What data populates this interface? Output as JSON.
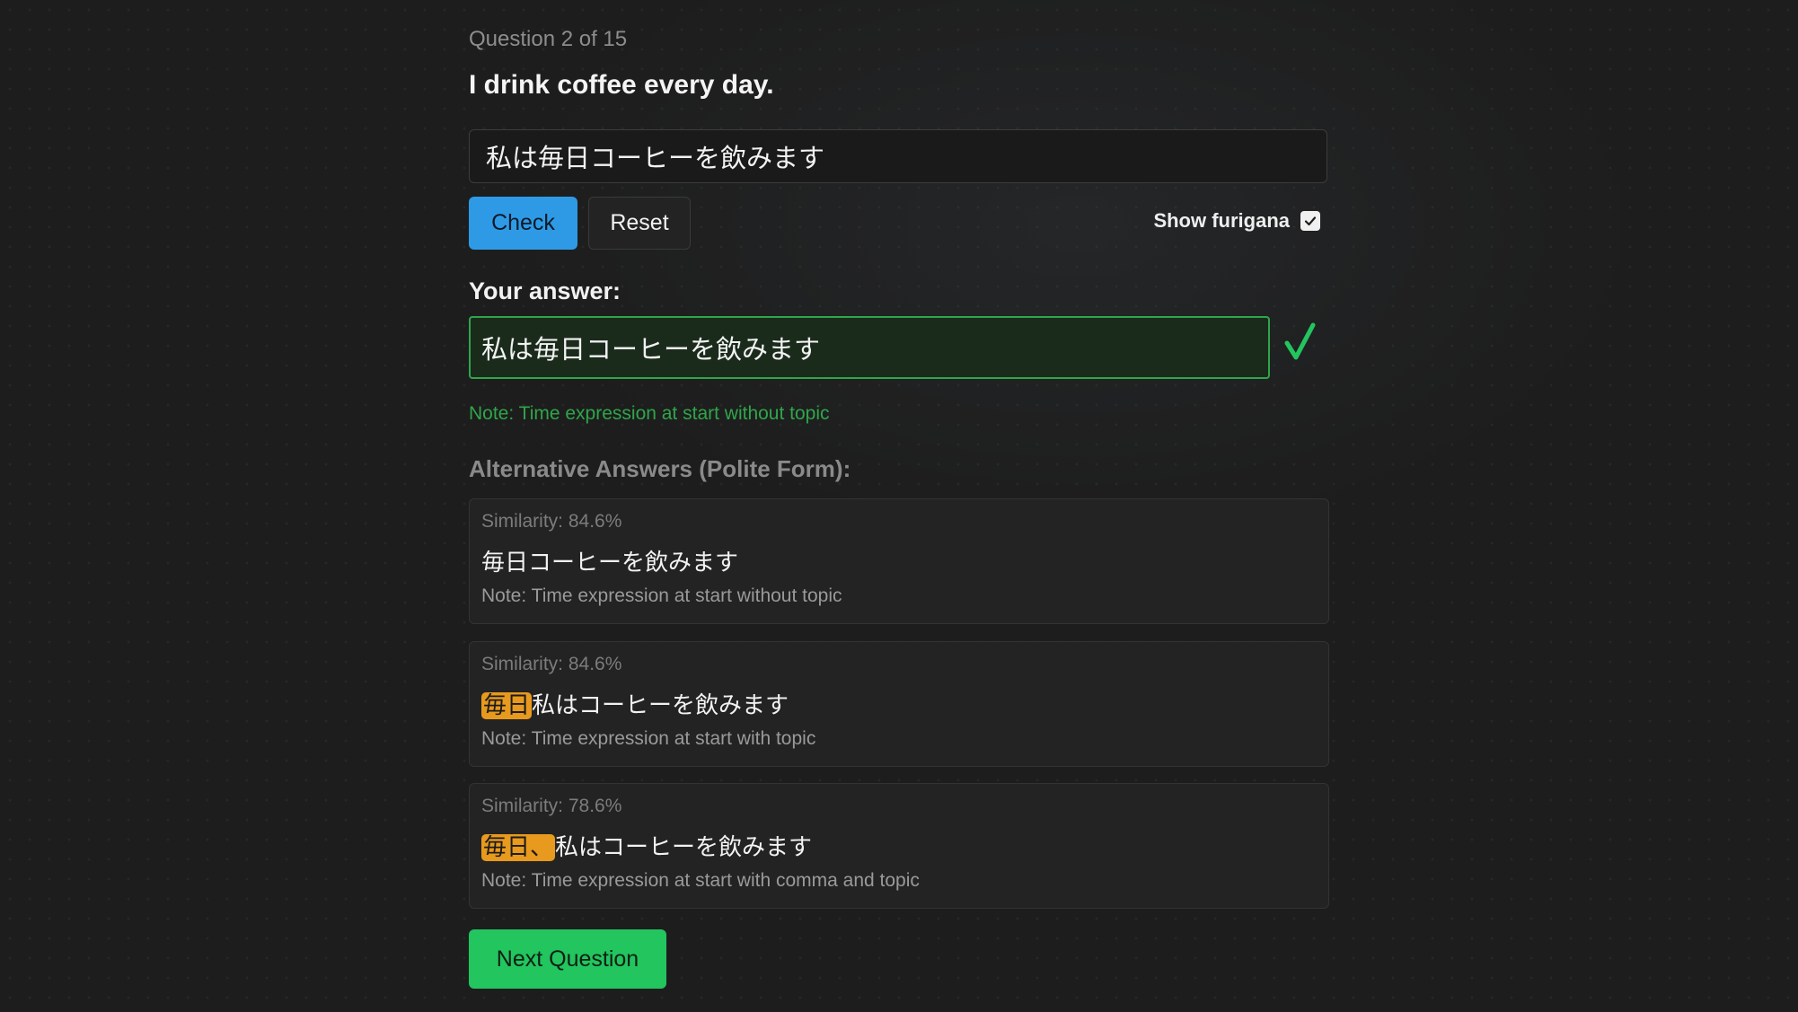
{
  "quiz": {
    "progress": "Question 2 of 15",
    "prompt": "I drink coffee every day."
  },
  "input": {
    "value": "私は毎日コーヒーを飲みます"
  },
  "controls": {
    "check_label": "Check",
    "reset_label": "Reset",
    "furigana_label": "Show furigana",
    "furigana_checked": true
  },
  "answer": {
    "label": "Your answer:",
    "value": "私は毎日コーヒーを飲みます",
    "correct": true,
    "note": "Note: Time expression at start without topic"
  },
  "alternatives": {
    "heading": "Alternative Answers (Polite Form):",
    "items": [
      {
        "similarity": "Similarity: 84.6%",
        "highlight": "",
        "rest": "毎日コーヒーを飲みます",
        "note": "Note: Time expression at start without topic"
      },
      {
        "similarity": "Similarity: 84.6%",
        "highlight": "毎日",
        "rest": "私はコーヒーを飲みます",
        "note": "Note: Time expression at start with topic"
      },
      {
        "similarity": "Similarity: 78.6%",
        "highlight": "毎日、",
        "rest": "私はコーヒーを飲みます",
        "note": "Note: Time expression at start with comma and topic"
      }
    ]
  },
  "next_label": "Next Question",
  "colors": {
    "accent_blue": "#2e9ae6",
    "success_green": "#22c55e",
    "highlight_orange": "#e79a1d"
  }
}
